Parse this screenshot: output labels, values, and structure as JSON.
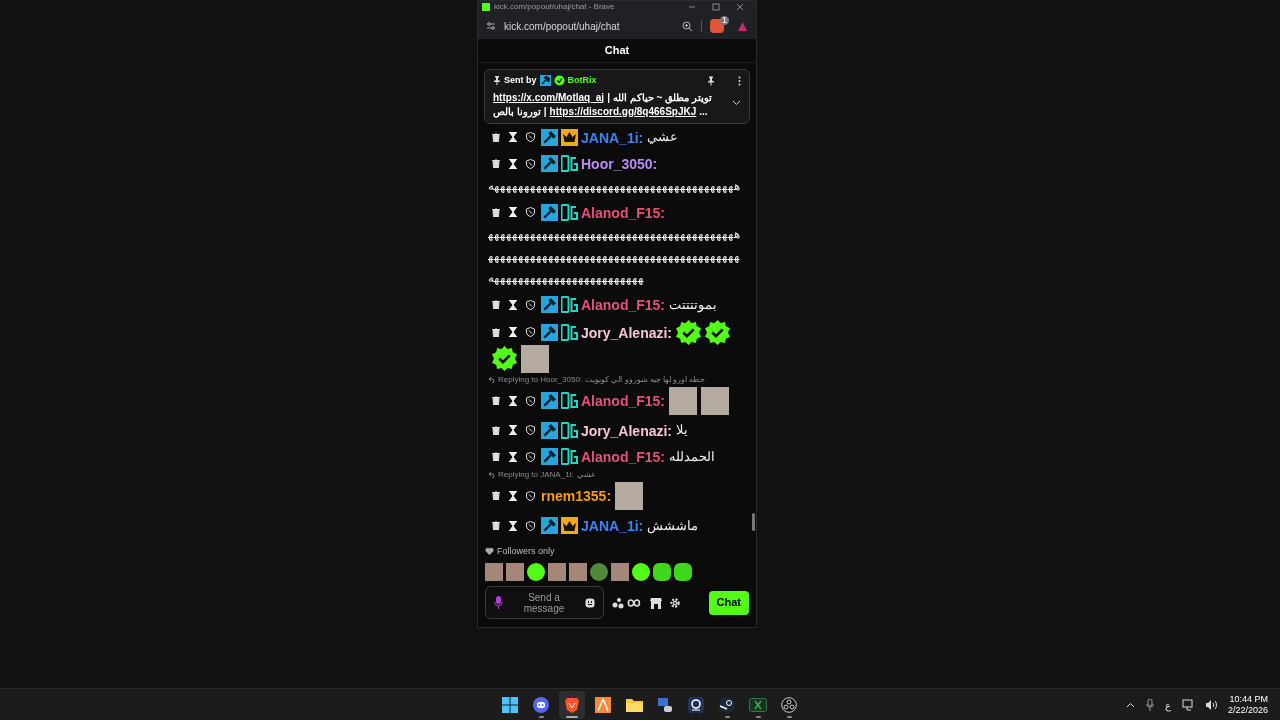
{
  "browser": {
    "title": "kick.com/popout/uhaj/chat - Brave",
    "url": "kick.com/popout/uhaj/chat",
    "shield_count": "1"
  },
  "chat": {
    "header": "Chat",
    "pinned": {
      "sent_by": "Sent by",
      "author": "BotRix",
      "lines": [
        [
          {
            "kind": "text",
            "text": "تويتر مطلق ~ حياكم الله"
          },
          {
            "kind": "text",
            "text": "|"
          },
          {
            "kind": "link",
            "text": "https://x.com/Motlaq_aj"
          }
        ],
        [
          {
            "kind": "text",
            "text": "..."
          },
          {
            "kind": "link",
            "text": "https://discord.gg/8q466SpJKJ"
          },
          {
            "kind": "text",
            "text": "|"
          },
          {
            "kind": "text",
            "text": "تورونا بالص"
          }
        ]
      ]
    },
    "messages": [
      {
        "name": "JANA_1i:",
        "color": "#3b82f6",
        "badges": [
          {
            "kind": "moderator"
          },
          {
            "kind": "crown"
          }
        ],
        "text": "عشي"
      },
      {
        "name": "Hoor_3050:",
        "color": "#b98cf5",
        "badges": [
          {
            "kind": "moderator"
          },
          {
            "kind": "og"
          }
        ],
        "text": "هههههههههههههههههههههههههههههههههههههههههه"
      },
      {
        "name": "Alanod_F15:",
        "color": "#e8507a",
        "badges": [
          {
            "kind": "moderator"
          },
          {
            "kind": "og"
          }
        ],
        "text": "هههههههههههههههههههههههههههههههههههههههههههههههههههههههههههههههههههههههههههههههههههههههههههههههههههههههههههههه"
      },
      {
        "name": "Alanod_F15:",
        "color": "#e8507a",
        "badges": [
          {
            "kind": "moderator"
          },
          {
            "kind": "og"
          }
        ],
        "text": "بموتتتتت"
      },
      {
        "name": "Jory_Alenazi:",
        "color": "#f5c6d6",
        "badges": [
          {
            "kind": "moderator"
          },
          {
            "kind": "og"
          }
        ],
        "emotes": [
          {
            "kind": "verified"
          },
          {
            "kind": "verified"
          },
          {
            "kind": "verified"
          },
          {
            "kind": "photo"
          }
        ]
      },
      {
        "reply": {
          "label": "Replying to Hoor_3050:",
          "text": "حطه اورو لها جبه شوروو الي كويويت"
        },
        "name": "Alanod_F15:",
        "color": "#e8507a",
        "badges": [
          {
            "kind": "moderator"
          },
          {
            "kind": "og"
          }
        ],
        "emotes": [
          {
            "kind": "photo"
          },
          {
            "kind": "photo"
          }
        ]
      },
      {
        "name": "Jory_Alenazi:",
        "color": "#f5c6d6",
        "badges": [
          {
            "kind": "moderator"
          },
          {
            "kind": "og"
          }
        ],
        "text": "يلا"
      },
      {
        "name": "Alanod_F15:",
        "color": "#e8507a",
        "badges": [
          {
            "kind": "moderator"
          },
          {
            "kind": "og"
          }
        ],
        "text": "الحمدلله"
      },
      {
        "reply": {
          "label": "Replying to JANA_1i:",
          "text": "عشي"
        },
        "name": "rnem1355:",
        "color": "#f59e0b",
        "emotes": [
          {
            "kind": "photo"
          }
        ]
      },
      {
        "name": "JANA_1i:",
        "color": "#3b82f6",
        "badges": [
          {
            "kind": "moderator"
          },
          {
            "kind": "crown"
          }
        ],
        "text": "ماششش"
      }
    ],
    "mode": "Followers only",
    "emotes": [
      {
        "kind": "photo"
      },
      {
        "kind": "photo"
      },
      {
        "kind": "face"
      },
      {
        "kind": "photo"
      },
      {
        "kind": "photo"
      },
      {
        "kind": "frog"
      },
      {
        "kind": "photo"
      },
      {
        "kind": "face"
      },
      {
        "kind": "blob"
      },
      {
        "kind": "blob"
      }
    ],
    "input": {
      "placeholder": "Send a message"
    },
    "send_button": "Chat"
  },
  "taskbar": {
    "apps": [
      {
        "kind": "start",
        "selected": false,
        "running": false
      },
      {
        "kind": "discord",
        "selected": false,
        "running": true
      },
      {
        "kind": "brave",
        "selected": true,
        "running": true
      },
      {
        "kind": "orange-app",
        "selected": false,
        "running": false
      },
      {
        "kind": "folder",
        "selected": false,
        "running": false
      },
      {
        "kind": "network",
        "selected": false,
        "running": false
      },
      {
        "kind": "webcam",
        "selected": false,
        "running": false
      },
      {
        "kind": "steam",
        "selected": false,
        "running": true
      },
      {
        "kind": "sheet",
        "selected": false,
        "running": true
      },
      {
        "kind": "obs",
        "selected": false,
        "running": true
      }
    ],
    "language": "ع",
    "time": "10:44 PM",
    "date": "2/22/2026"
  }
}
